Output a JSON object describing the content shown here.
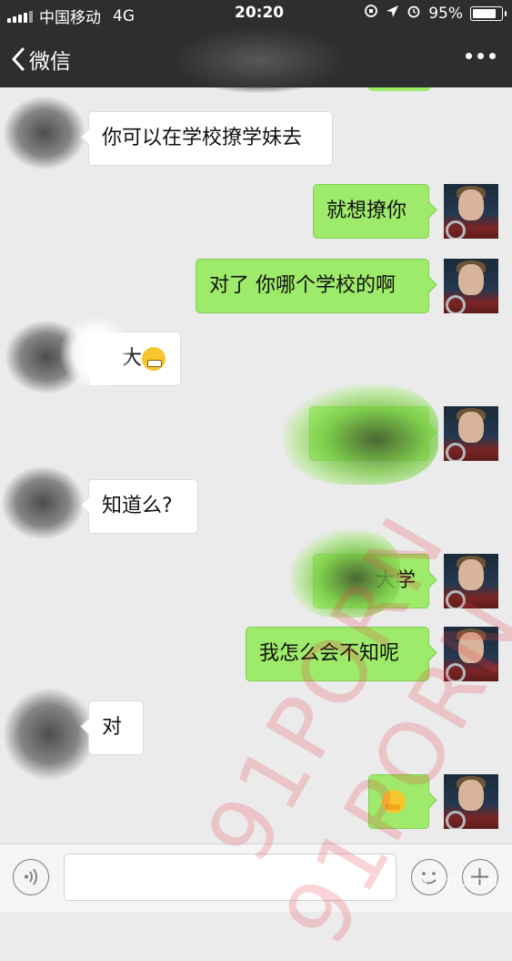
{
  "status_bar": {
    "carrier": "中国移动",
    "network": "4G",
    "time": "20:20",
    "battery": "95%",
    "battery_level": 0.95
  },
  "nav": {
    "back_label": "微信",
    "back_icon": "chevron-left-icon",
    "more_icon": "more-dots-icon"
  },
  "messages": [
    {
      "side": "in",
      "text": "你可以在学校撩学妹去"
    },
    {
      "side": "out",
      "text": "就想撩你"
    },
    {
      "side": "out",
      "text": "对了 你哪个学校的啊"
    },
    {
      "side": "in",
      "text": "大",
      "emoji": "grimace-emoji"
    },
    {
      "side": "out",
      "text": ""
    },
    {
      "side": "in",
      "text": "知道么?"
    },
    {
      "side": "out",
      "text": "大学"
    },
    {
      "side": "out",
      "text": "我怎么会不知呢"
    },
    {
      "side": "in",
      "text": "对"
    },
    {
      "side": "out",
      "text": "",
      "emoji": "hug-emoji"
    }
  ],
  "input_bar": {
    "voice_icon": "voice-icon",
    "emoji_icon": "emoji-icon",
    "plus_icon": "plus-icon"
  },
  "watermark": {
    "text": "91PORN",
    "corner": "S..jizh.com"
  },
  "colors": {
    "bar": "#2e2e2e",
    "background": "#ebebeb",
    "outgoing_bubble": "#9eea6a",
    "incoming_bubble": "#ffffff"
  }
}
